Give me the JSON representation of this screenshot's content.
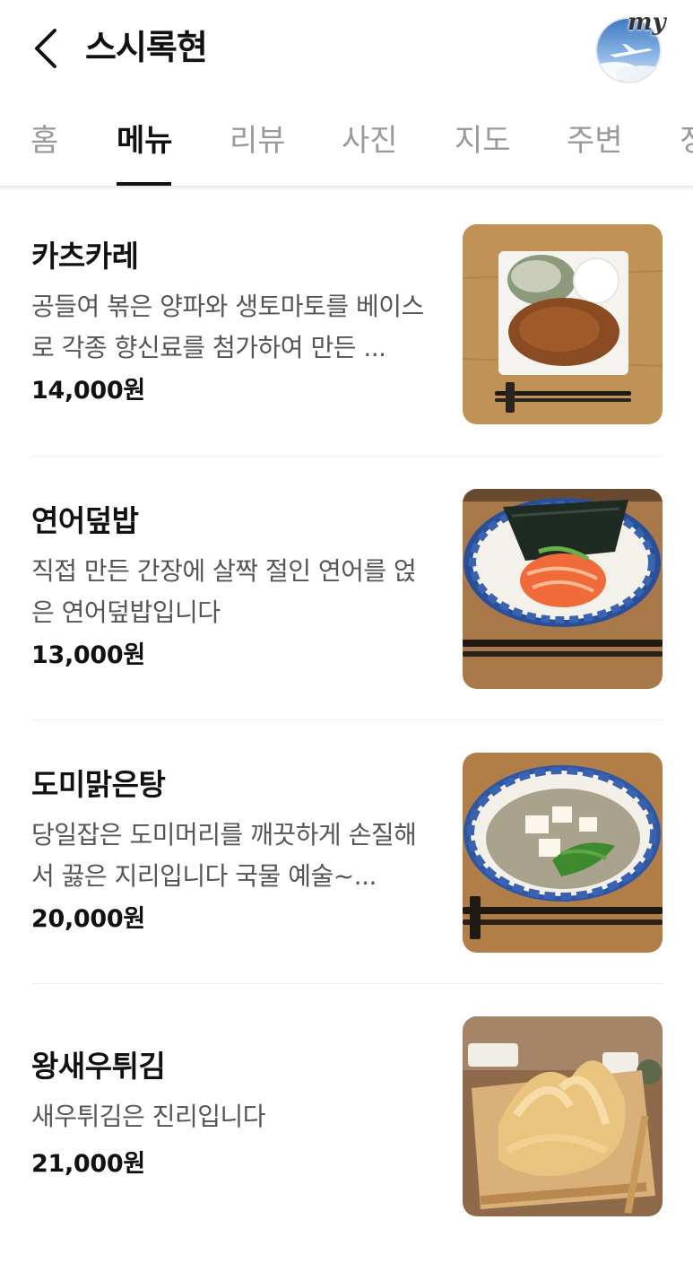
{
  "header": {
    "title": "스시록현",
    "avatar_badge": "my"
  },
  "tabs": [
    {
      "label": "홈",
      "active": false
    },
    {
      "label": "메뉴",
      "active": true
    },
    {
      "label": "리뷰",
      "active": false
    },
    {
      "label": "사진",
      "active": false
    },
    {
      "label": "지도",
      "active": false
    },
    {
      "label": "주변",
      "active": false
    },
    {
      "label": "정",
      "active": false
    }
  ],
  "menu": [
    {
      "name": "카츠카레",
      "description": "공들여 볶은 양파와 생토마토를 베이스로 각종 향신료를 첨가하여 만든 ...",
      "price": "14,000원",
      "photo": "katsu-curry-plate-image"
    },
    {
      "name": "연어덮밥",
      "description": "직접 만든 간장에 살짝 절인 연어를 얹은 연어덮밥입니다",
      "price": "13,000원",
      "photo": "salmon-rice-bowl-image"
    },
    {
      "name": "도미맑은탕",
      "description": "당일잡은 도미머리를 깨끗하게 손질해서 끓은 지리입니다 국물 예술~...",
      "price": "20,000원",
      "photo": "sea-bream-soup-image"
    },
    {
      "name": "왕새우튀김",
      "description": "새우튀김은 진리입니다",
      "price": "21,000원",
      "photo": "shrimp-tempura-image"
    }
  ],
  "colors": {
    "active_tab": "#111111",
    "inactive_tab": "#9a9a9a",
    "description": "#555555",
    "divider": "#ececec"
  }
}
